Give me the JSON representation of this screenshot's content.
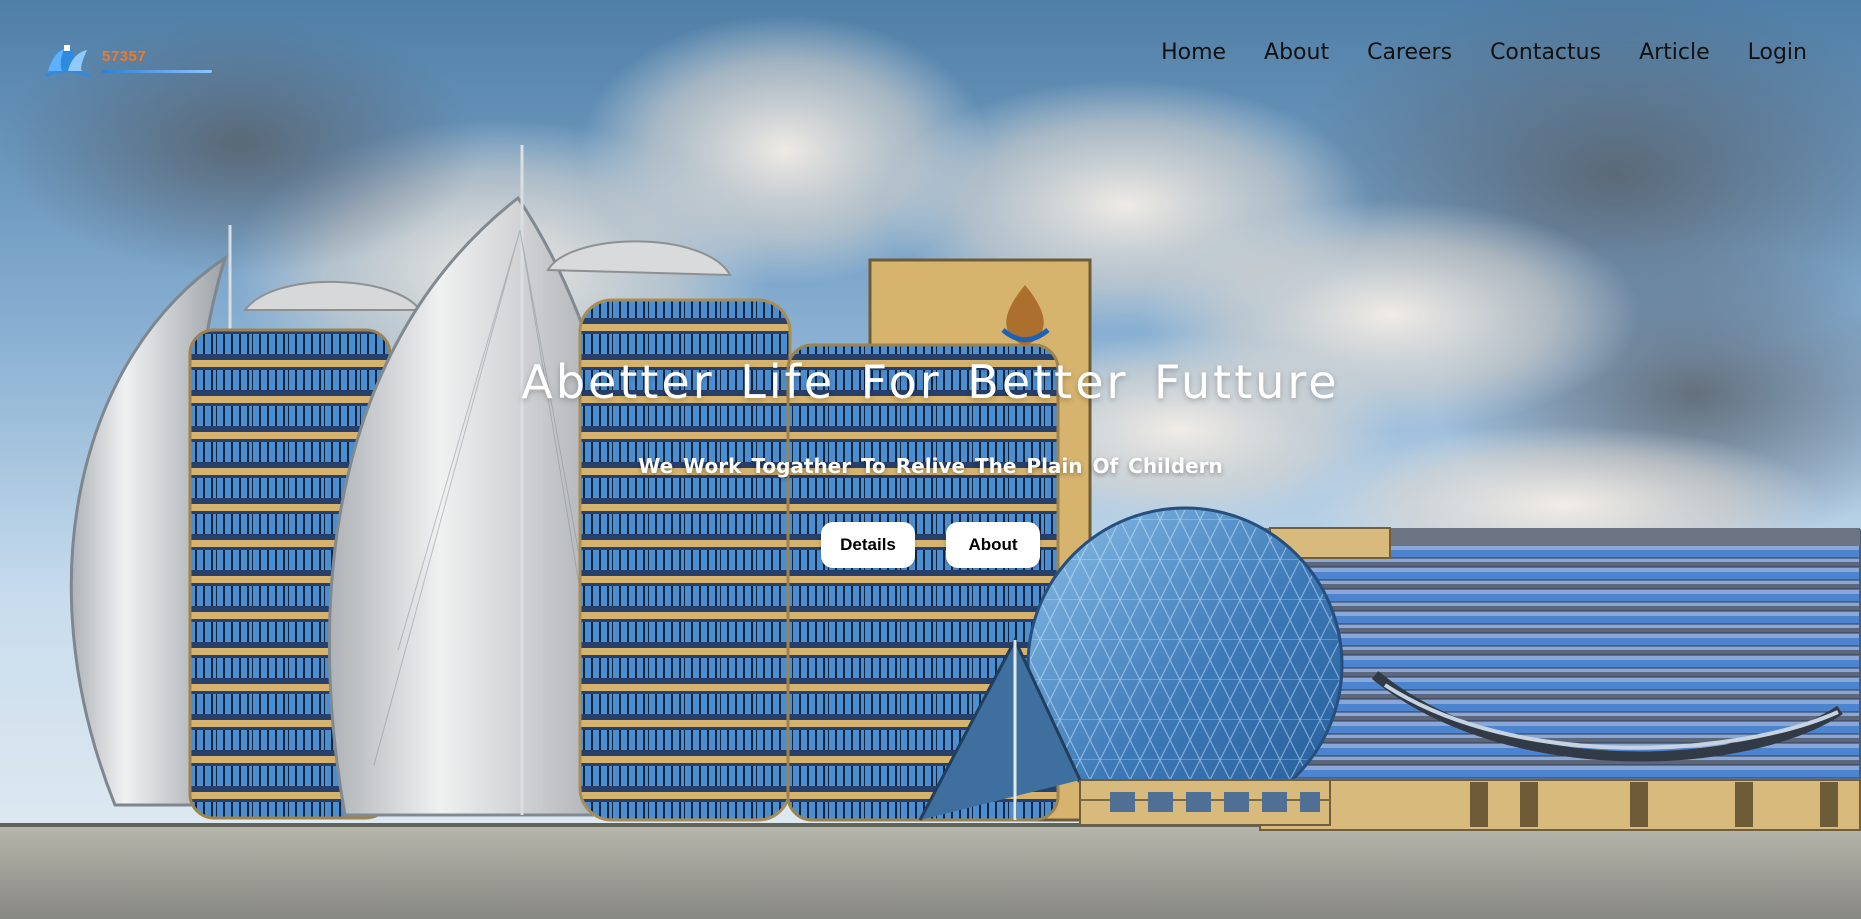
{
  "header": {
    "logo_number": "57357",
    "nav_items": [
      {
        "label": "Home"
      },
      {
        "label": "About"
      },
      {
        "label": "Careers"
      },
      {
        "label": "Contactus"
      },
      {
        "label": "Article"
      },
      {
        "label": "Login"
      }
    ]
  },
  "hero": {
    "title": "Abetter Life For Better Futture",
    "subtitle": "We Work Togather To Relive The Plain Of Childern",
    "buttons": {
      "details": "Details",
      "about": "About"
    }
  },
  "colors": {
    "nav_text": "#111111",
    "hero_text": "#ffffff",
    "button_bg": "#ffffff",
    "logo_accent": "#f07a2a",
    "building_blue": "#3f7fc1",
    "building_sand": "#d8b979"
  },
  "icons": {
    "logo": "hospital-logo-icon"
  }
}
